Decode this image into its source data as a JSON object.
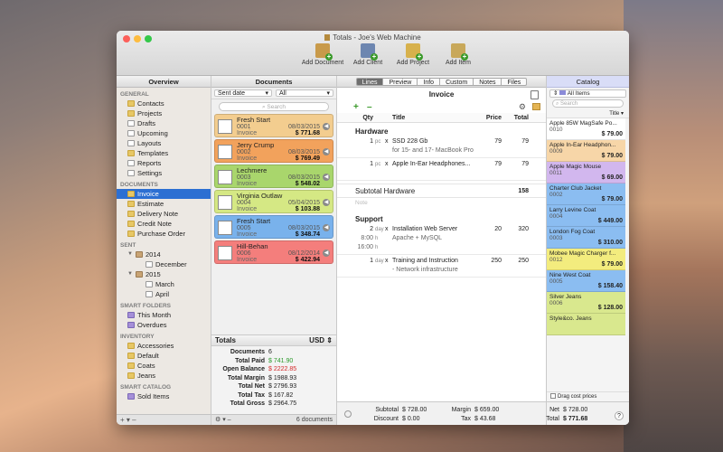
{
  "window": {
    "title": "Totals - Joe's Web Machine"
  },
  "toolbar": [
    {
      "label": "Add Document",
      "color": "#c89a4a"
    },
    {
      "label": "Add Client",
      "color": "#6d86b0"
    },
    {
      "label": "Add Project",
      "color": "#d7b14c"
    },
    {
      "label": "Add Item",
      "color": "#c8a85a"
    }
  ],
  "sidebar": {
    "header": "Overview",
    "sections": [
      {
        "title": "GENERAL",
        "items": [
          {
            "label": "Contacts",
            "icon": "contacts-icon",
            "cls": "folder",
            "lvl": ""
          },
          {
            "label": "Projects",
            "icon": "projects-icon",
            "cls": "folder",
            "lvl": ""
          },
          {
            "label": "Drafts",
            "icon": "drafts-icon",
            "cls": "doc",
            "lvl": ""
          },
          {
            "label": "Upcoming",
            "icon": "upcoming-icon",
            "cls": "doc",
            "lvl": ""
          },
          {
            "label": "Layouts",
            "icon": "layouts-icon",
            "cls": "doc",
            "lvl": ""
          },
          {
            "label": "Templates",
            "icon": "templates-icon",
            "cls": "folder",
            "lvl": ""
          },
          {
            "label": "Reports",
            "icon": "reports-icon",
            "cls": "doc",
            "lvl": ""
          },
          {
            "label": "Settings",
            "icon": "gear-icon",
            "cls": "doc",
            "lvl": ""
          }
        ]
      },
      {
        "title": "DOCUMENTS",
        "items": [
          {
            "label": "Invoice",
            "icon": "invoice-folder-icon",
            "cls": "folder",
            "lvl": "",
            "selected": true
          },
          {
            "label": "Estimate",
            "icon": "estimate-folder-icon",
            "cls": "folder",
            "lvl": ""
          },
          {
            "label": "Delivery Note",
            "icon": "delivery-note-folder-icon",
            "cls": "folder",
            "lvl": ""
          },
          {
            "label": "Credit Note",
            "icon": "credit-note-folder-icon",
            "cls": "folder",
            "lvl": ""
          },
          {
            "label": "Purchase Order",
            "icon": "purchase-order-folder-icon",
            "cls": "folder",
            "lvl": ""
          }
        ]
      },
      {
        "title": "SENT",
        "items": [
          {
            "label": "2014",
            "icon": "box-icon",
            "cls": "box",
            "lvl": "",
            "tri": "▼"
          },
          {
            "label": "December",
            "icon": "month-folder-icon",
            "cls": "doc",
            "lvl": "sub2"
          },
          {
            "label": "2015",
            "icon": "box-icon",
            "cls": "box",
            "lvl": "",
            "tri": "▼"
          },
          {
            "label": "March",
            "icon": "month-folder-icon",
            "cls": "doc",
            "lvl": "sub2"
          },
          {
            "label": "April",
            "icon": "month-folder-icon",
            "cls": "doc",
            "lvl": "sub2"
          }
        ]
      },
      {
        "title": "SMART FOLDERS",
        "items": [
          {
            "label": "This Month",
            "icon": "smart-folder-icon",
            "cls": "smart",
            "lvl": ""
          },
          {
            "label": "Overdues",
            "icon": "smart-folder-icon",
            "cls": "smart",
            "lvl": ""
          }
        ]
      },
      {
        "title": "INVENTORY",
        "items": [
          {
            "label": "Accessories",
            "icon": "inventory-folder-icon",
            "cls": "folder",
            "lvl": ""
          },
          {
            "label": "Default",
            "icon": "inventory-folder-icon",
            "cls": "folder",
            "lvl": ""
          },
          {
            "label": "Coats",
            "icon": "inventory-folder-icon",
            "cls": "folder",
            "lvl": ""
          },
          {
            "label": "Jeans",
            "icon": "inventory-folder-icon",
            "cls": "folder",
            "lvl": ""
          }
        ]
      },
      {
        "title": "SMART CATALOG",
        "items": [
          {
            "label": "Sold Items",
            "icon": "smart-catalog-icon",
            "cls": "smart",
            "lvl": ""
          }
        ]
      }
    ],
    "bottom": "+ ▾   –"
  },
  "documents": {
    "header": "Documents",
    "sort": "Sent date",
    "filter": "All",
    "search_placeholder": "Search",
    "cards": [
      {
        "name": "Fresh Start",
        "num": "0001",
        "date": "08/03/2015",
        "type": "Invoice",
        "amount": "$ 771.68",
        "bg": "#f3cd8f"
      },
      {
        "name": "Jerry Crump",
        "num": "0002",
        "date": "08/03/2015",
        "type": "Invoice",
        "amount": "$ 769.49",
        "bg": "#f2a25c"
      },
      {
        "name": "Lechmere",
        "num": "0003",
        "date": "08/03/2015",
        "type": "Invoice",
        "amount": "$ 548.02",
        "bg": "#a9d66c"
      },
      {
        "name": "Virginia Outlaw",
        "num": "0004",
        "date": "05/04/2015",
        "type": "Invoice",
        "amount": "$ 103.88",
        "bg": "#d5e884"
      },
      {
        "name": "Fresh Start",
        "num": "0005",
        "date": "08/03/2015",
        "type": "Invoice",
        "amount": "$ 348.74",
        "bg": "#79b2ec"
      },
      {
        "name": "Hill-Behan",
        "num": "0006",
        "date": "08/12/2014",
        "type": "Invoice",
        "amount": "$ 422.94",
        "bg": "#f47e7c"
      }
    ],
    "totals": {
      "label": "Totals",
      "currency": "USD",
      "rows": [
        {
          "k": "Documents",
          "v": "6",
          "color": "#222"
        },
        {
          "k": "Total Paid",
          "v": "$ 741.90",
          "color": "#2b9a2b"
        },
        {
          "k": "Open Balance",
          "v": "$ 2222.85",
          "color": "#d42a2a"
        },
        {
          "k": "Total Margin",
          "v": "$ 1988.93",
          "color": "#222"
        },
        {
          "k": "Total Net",
          "v": "$ 2796.93",
          "color": "#222"
        },
        {
          "k": "Total Tax",
          "v": "$ 167.82",
          "color": "#222"
        },
        {
          "k": "Total Gross",
          "v": "$ 2964.75",
          "color": "#222"
        }
      ]
    },
    "bottom_left": "⚙ ▾   –",
    "bottom_count": "6 documents"
  },
  "invoice": {
    "tabs": [
      "Lines",
      "Preview",
      "Info",
      "Custom",
      "Notes",
      "Files"
    ],
    "active_tab": "Lines",
    "title": "Invoice",
    "cols": {
      "qty": "Qty",
      "title": "Title",
      "price": "Price",
      "total": "Total"
    },
    "groups": [
      {
        "name": "Hardware",
        "lines": [
          {
            "qty": "1",
            "unit": "pc",
            "title": "SSD 228 Gb",
            "desc": "for 15- and 17- MacBook Pro",
            "price": "79",
            "total": "79"
          },
          {
            "qty": "1",
            "unit": "pc",
            "title": "Apple In-Ear Headphones...",
            "desc": "",
            "price": "79",
            "total": "79"
          }
        ],
        "subtotal_label": "Subtotal Hardware",
        "subtotal": "158",
        "note": "Note"
      },
      {
        "name": "Support",
        "lines": [
          {
            "qty": "2",
            "unit": "day",
            "title": "Installation Web Server",
            "desc": "Apache + MySQL",
            "price": "20",
            "total": "320",
            "extra_qty": [
              "8:00",
              "16:00"
            ],
            "extra_unit": [
              "h",
              "h"
            ]
          },
          {
            "qty": "1",
            "unit": "day",
            "title": "Training and Instruction",
            "desc": "- Network infrastructure",
            "price": "250",
            "total": "250"
          }
        ]
      }
    ],
    "footer": {
      "subtotal_label": "Subtotal",
      "subtotal": "$ 728.00",
      "discount_label": "Discount",
      "discount": "$ 0.00",
      "margin_label": "Margin",
      "margin": "$ 659.00",
      "tax_label": "Tax",
      "tax": "$ 43.68",
      "net_label": "Net",
      "net": "$ 728.00",
      "total_label": "Total",
      "total": "$ 771.68"
    }
  },
  "catalog": {
    "header": "Catalog",
    "selector": "All Items",
    "search_placeholder": "Search",
    "sort": "Title",
    "items": [
      {
        "name": "Apple 85W MagSafe Po...",
        "code": "0010",
        "price": "$ 79.00",
        "bg": "#ffffff"
      },
      {
        "name": "Apple In-Ear Headphon...",
        "code": "0009",
        "price": "$ 79.00",
        "bg": "#f7d6a8"
      },
      {
        "name": "Apple Magic Mouse",
        "code": "0011",
        "price": "$ 69.00",
        "bg": "#d2b7ee"
      },
      {
        "name": "Charter Club Jacket",
        "code": "0002",
        "price": "$ 79.00",
        "bg": "#8bbdf1"
      },
      {
        "name": "Larry Levine Coat",
        "code": "0004",
        "price": "$ 449.00",
        "bg": "#8bbdf1"
      },
      {
        "name": "London Fog Coat",
        "code": "0003",
        "price": "$ 310.00",
        "bg": "#8bbdf1"
      },
      {
        "name": "Mobee Magic Charger f...",
        "code": "0012",
        "price": "$ 79.00",
        "bg": "#f3ec7e"
      },
      {
        "name": "Nine West Coat",
        "code": "0005",
        "price": "$ 158.40",
        "bg": "#8bbdf1"
      },
      {
        "name": "Silver Jeans",
        "code": "0006",
        "price": "$ 128.00",
        "bg": "#d9e88e"
      },
      {
        "name": "Style&co. Jeans",
        "code": "",
        "price": "",
        "bg": "#d9e88e"
      }
    ],
    "drag_label": "Drag cost prices",
    "help": "?"
  }
}
